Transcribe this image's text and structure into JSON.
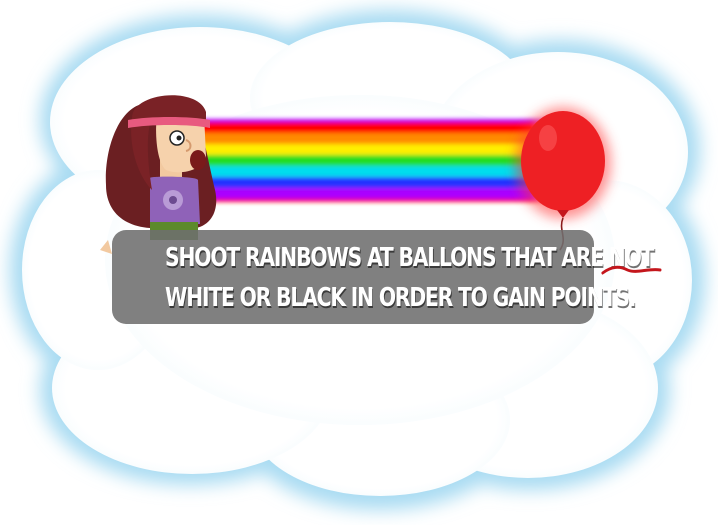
{
  "tutorial": {
    "line1_prefix": "SHOOT RAINBOWS AT BALLONS THAT ARE ",
    "line1_emphasis": "NOT",
    "line2": "WHITE OR BLACK IN ORDER TO GAIN POINTS."
  },
  "colors": {
    "cloud_fill": "#ffffff",
    "cloud_glow": "#bfe3f5",
    "caption_bg": "#6e6e6e",
    "balloon": "#ee2024",
    "underline": "#c4161c",
    "rainbow": [
      "#ff0000",
      "#ff8a00",
      "#ffee00",
      "#22dd22",
      "#00ddee",
      "#2233ff",
      "#aa00ff"
    ]
  },
  "icons": {
    "character": "hippie-character",
    "balloon": "red-balloon",
    "beam": "rainbow-beam"
  }
}
